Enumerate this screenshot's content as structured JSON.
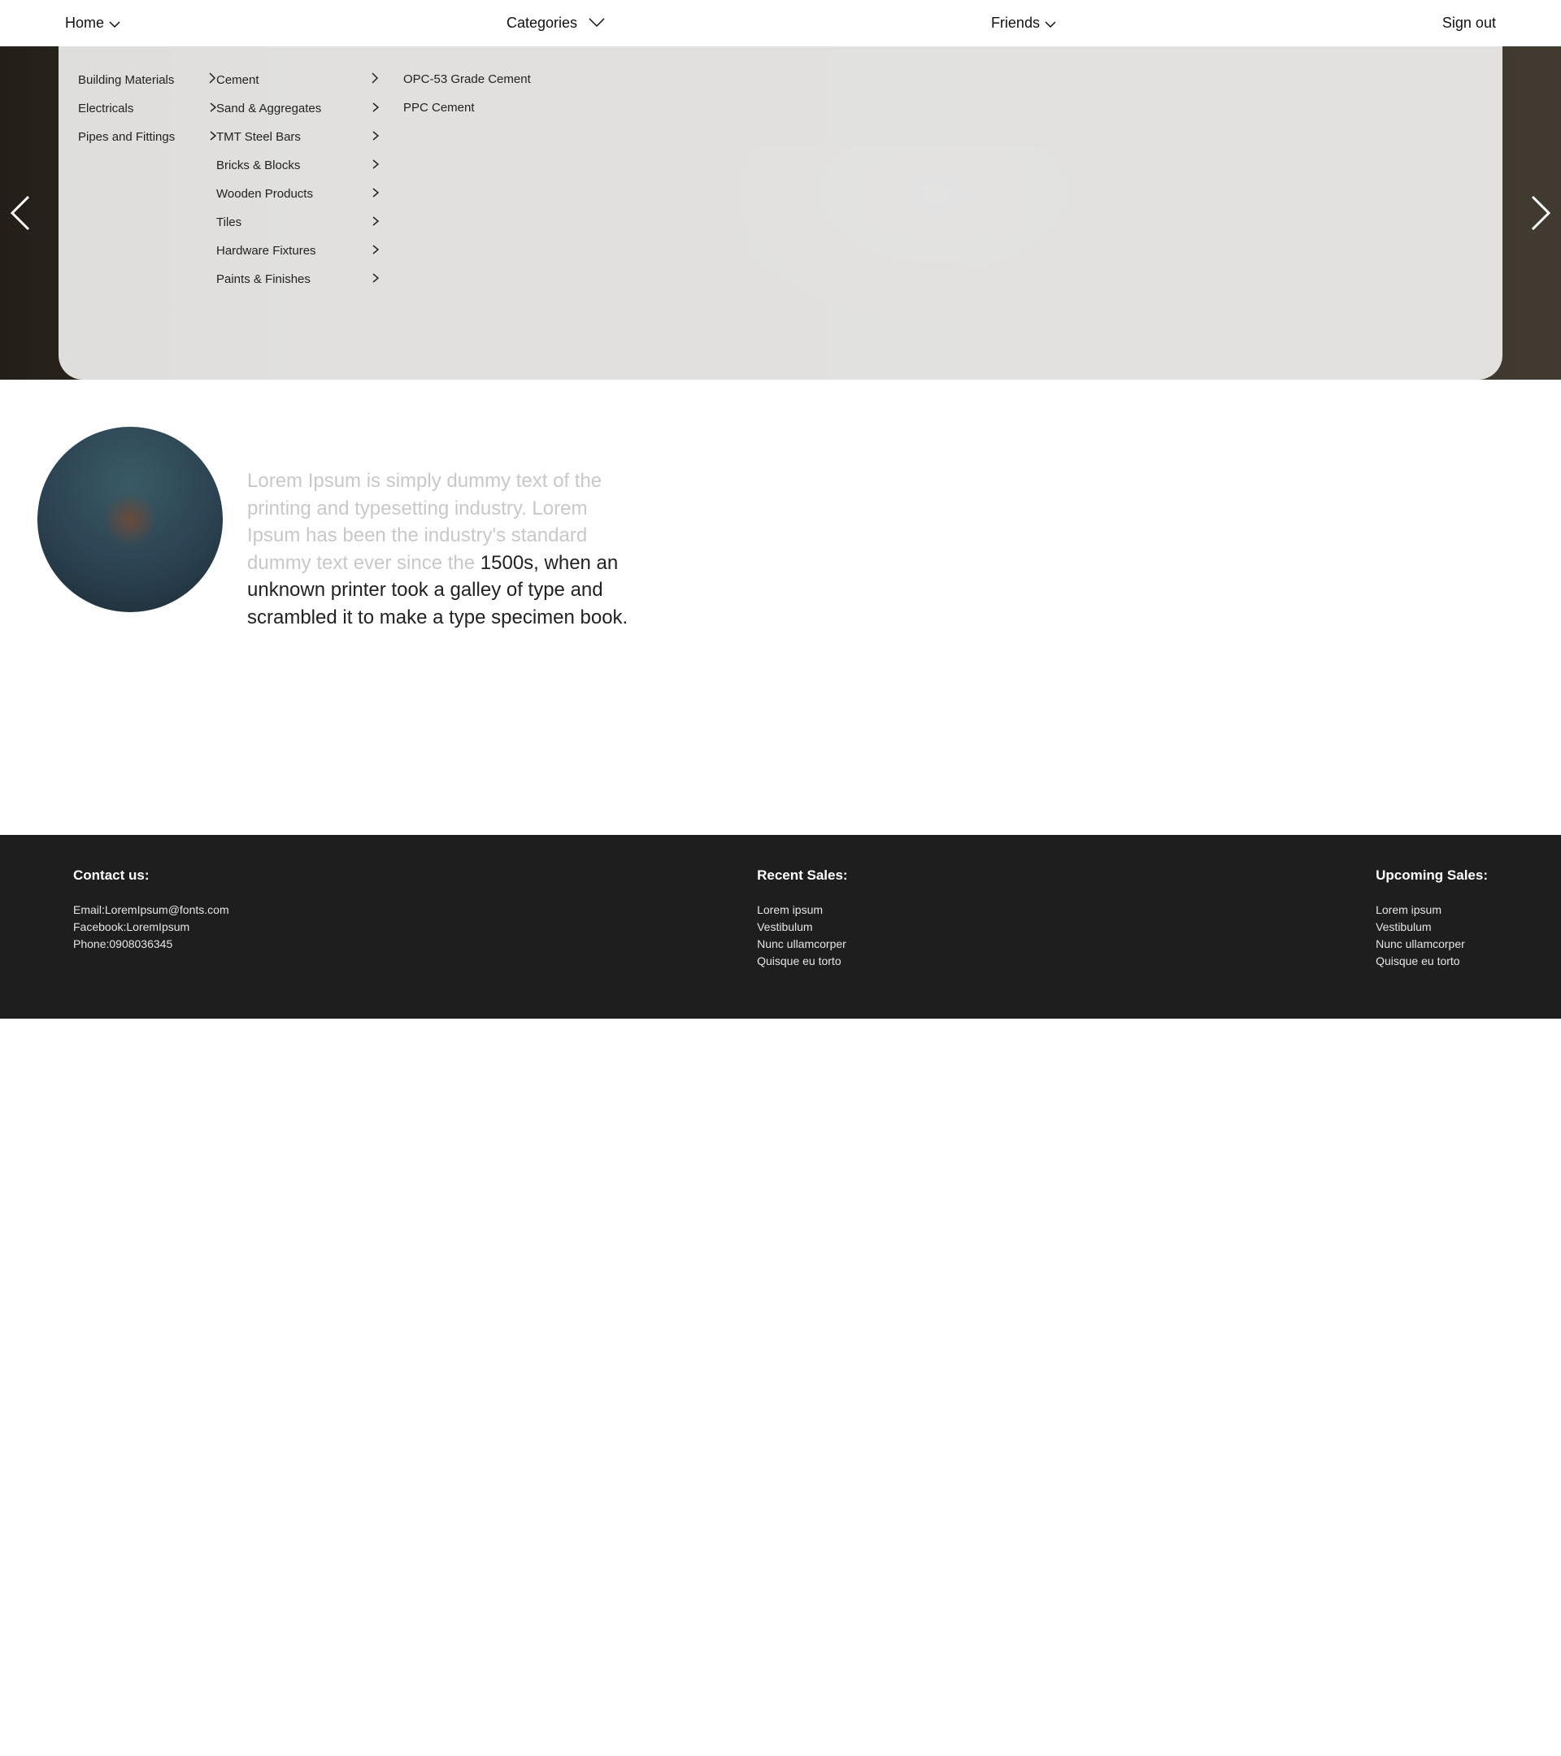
{
  "nav": {
    "home": "Home",
    "categories": "Categories",
    "friends": "Friends",
    "signout": "Sign out"
  },
  "menu": {
    "col1": [
      {
        "label": "Building Materials"
      },
      {
        "label": "Electricals"
      },
      {
        "label": "Pipes and Fittings"
      }
    ],
    "col2": [
      {
        "label": "Cement"
      },
      {
        "label": "Sand & Aggregates"
      },
      {
        "label": "TMT Steel Bars"
      },
      {
        "label": "Bricks & Blocks"
      },
      {
        "label": "Wooden Products"
      },
      {
        "label": "Tiles"
      },
      {
        "label": "Hardware Fixtures"
      },
      {
        "label": "Paints & Finishes"
      }
    ],
    "col3": [
      {
        "label": "OPC-53 Grade Cement"
      },
      {
        "label": "PPC Cement"
      }
    ]
  },
  "testimonial": {
    "faded": "Lorem Ipsum is simply dummy text of the printing and typesetting industry. Lorem Ipsum has been the industry's standard dummy text ever since the ",
    "solid": "1500s, when an unknown printer took a galley of type and scrambled it to make a type specimen book."
  },
  "footer": {
    "contact": {
      "title": "Contact us:",
      "email": "Email:LoremIpsum@fonts.com",
      "facebook": "Facebook:LoremIpsum",
      "phone": "Phone:0908036345"
    },
    "recent": {
      "title": "Recent Sales:",
      "items": [
        "Lorem ipsum",
        "Vestibulum",
        "Nunc ullamcorper",
        "Quisque eu torto"
      ]
    },
    "upcoming": {
      "title": "Upcoming Sales:",
      "items": [
        "Lorem ipsum",
        "Vestibulum",
        "Nunc ullamcorper",
        "Quisque eu torto"
      ]
    }
  }
}
